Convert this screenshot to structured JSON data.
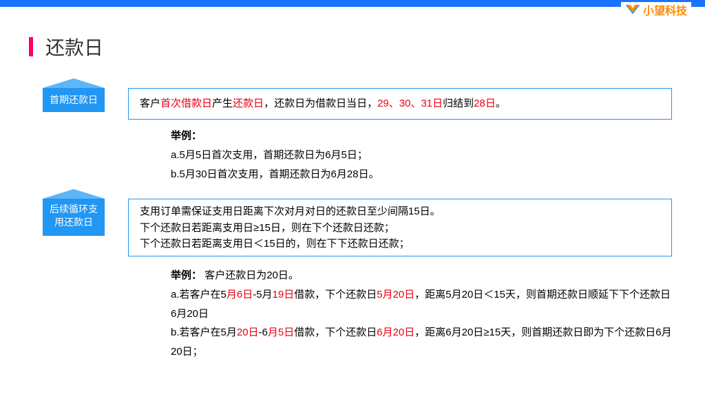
{
  "brand": "小望科技",
  "title": "还款日",
  "section1": {
    "tag": "首期还款日",
    "rule": {
      "p1": "客户",
      "r1": "首次借款日",
      "p2": "产生",
      "r2": "还款日",
      "p3": "，还款日为借款日当日，",
      "r3": "29、30、31日",
      "p4": "归结到",
      "r4": "28日",
      "p5": "。"
    },
    "examples": {
      "label": "举例：",
      "a": "a.5月5日首次支用，首期还款日为6月5日；",
      "b": "b.5月30日首次支用，首期还款日为6月28日。"
    }
  },
  "section2": {
    "tag": "后续循环支用还款日",
    "rule": {
      "l1": "支用订单需保证支用日距离下次对月对日的还款日至少间隔15日。",
      "l2": "下个还款日若距离支用日≥15日，则在下个还款日还款；",
      "l3": "下个还款日若距离支用日＜15日的，则在下下还款日还款；"
    },
    "examples": {
      "label": "举例：",
      "intro": "客户还款日为20日。",
      "a": {
        "p1": "a.若客户在5",
        "r1": "月6日",
        "p2": "-5月",
        "r2": "19日",
        "p3": "借款，下个还款日",
        "r3": "5月20日",
        "p4": "，距离5月20日＜15天，则首期还款日顺延下下个还款日6月20日"
      },
      "b": {
        "p1": "b.若客户在5月",
        "r1": "20日",
        "p2": "-6",
        "r2": "月5日",
        "p3": "借款，下个还款日",
        "r3": "6月20日",
        "p4": "，距离6月20日≥15天，则首期还款日即为下个还款日6月20日；"
      }
    }
  }
}
